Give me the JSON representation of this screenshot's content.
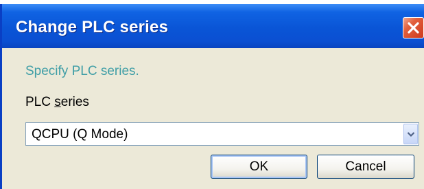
{
  "window": {
    "title": "Change PLC series",
    "close_icon": "close-icon"
  },
  "main": {
    "prompt": "Specify PLC series.",
    "series_label_prefix": "PLC ",
    "series_label_mnemonic": "s",
    "series_label_suffix": "eries",
    "series_select": {
      "selected": "QCPU (Q Mode)",
      "arrow_icon": "chevron-down-icon"
    }
  },
  "buttons": {
    "ok_label": "OK",
    "cancel_label": "Cancel"
  },
  "colors": {
    "titlebar": "#0a55d6",
    "prompt_text": "#3f9ea6",
    "dialog_bg": "#ece9d8",
    "close_button": "#e2603d"
  }
}
